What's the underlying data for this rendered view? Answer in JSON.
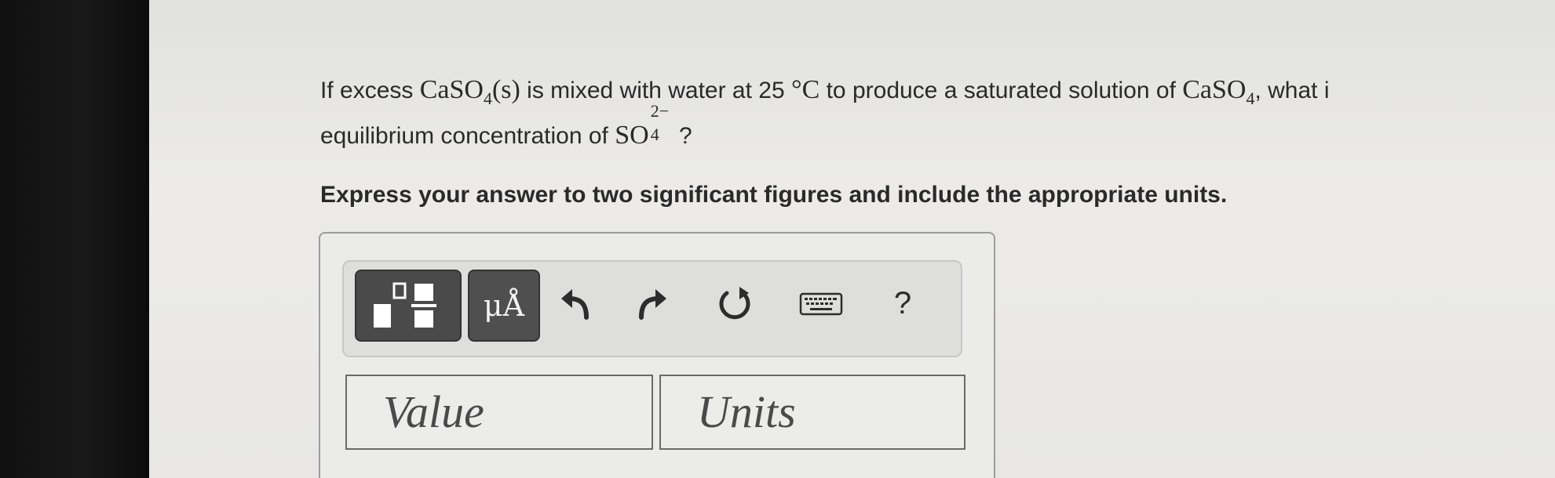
{
  "question": {
    "prefix": "If excess ",
    "formula1": "CaSO",
    "formula1_sub": "4",
    "phase": "(s)",
    "mid1": " is mixed with water at 25 ",
    "temperature_unit": "°C",
    "mid2": " to produce a saturated solution of ",
    "formula2": "CaSO",
    "formula2_sub": "4",
    "mid3": ", what i",
    "line2_prefix": "equilibrium concentration of ",
    "ion": "SO",
    "ion_sup": "2−",
    "ion_sub": "4",
    "line2_suffix": " ?"
  },
  "instruction": "Express your answer to two significant figures and include the appropriate units.",
  "toolbar": {
    "units_label": "μÅ",
    "help_label": "?"
  },
  "icons": {
    "templates": "templates-icon",
    "undo": "undo-icon",
    "redo": "redo-icon",
    "reset": "reset-icon",
    "keyboard": "keyboard-icon"
  },
  "inputs": {
    "value_placeholder": "Value",
    "units_placeholder": "Units"
  },
  "colors": {
    "button_dark": "#4a4a4a",
    "page_background": "#e9e9e7",
    "bezel": "#141414"
  }
}
